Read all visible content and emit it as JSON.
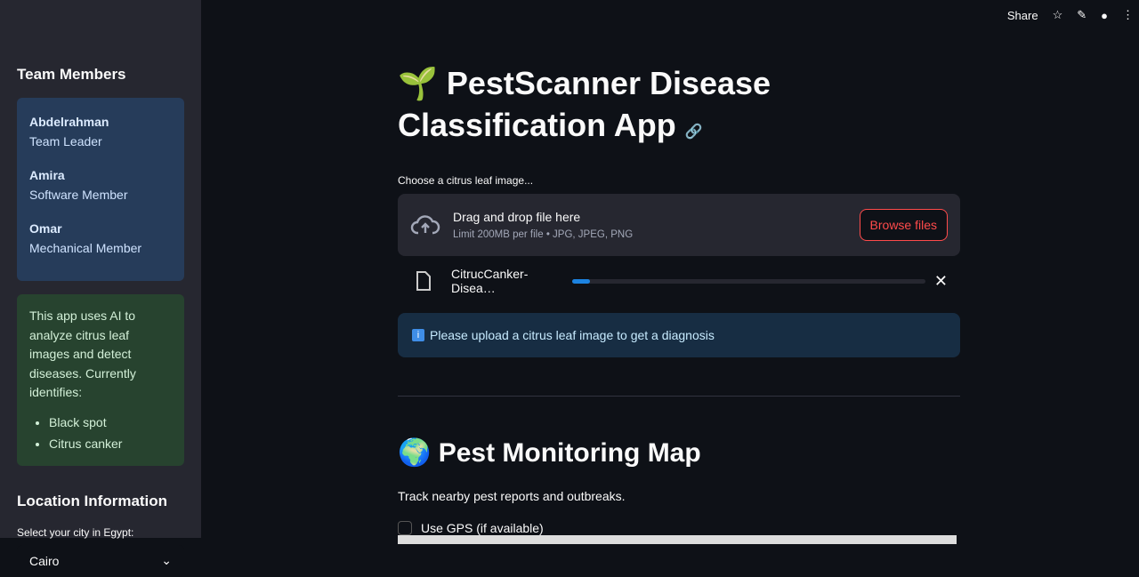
{
  "header": {
    "share": "Share",
    "icons": [
      "star-icon",
      "pencil-icon",
      "github-icon",
      "more-icon"
    ]
  },
  "sidebar": {
    "team_title": "Team Members",
    "members": [
      {
        "name": "Abdelrahman",
        "role": "Team Leader"
      },
      {
        "name": "Amira",
        "role": "Software Member"
      },
      {
        "name": "Omar",
        "role": "Mechanical Member"
      }
    ],
    "about": "This app uses AI to analyze citrus leaf images and detect diseases. Currently identifies:",
    "diseases": [
      "Black spot",
      "Citrus canker"
    ],
    "location_title": "Location Information",
    "city_label": "Select your city in Egypt:",
    "city_value": "Cairo"
  },
  "main": {
    "title_emoji": "🌱",
    "title": "PestScanner Disease Classification App",
    "uploader_label": "Choose a citrus leaf image...",
    "drop_text": "Drag and drop file here",
    "limit_text": "Limit 200MB per file • JPG, JPEG, PNG",
    "browse": "Browse files",
    "file_name": "CitrucCanker-Disea…",
    "upload_progress": 0.01,
    "info": "Please upload a citrus leaf image to get a diagnosis",
    "map_emoji": "🌍",
    "map_title": "Pest Monitoring Map",
    "map_desc": "Track nearby pest reports and outbreaks.",
    "gps_label": "Use GPS (if available)"
  }
}
